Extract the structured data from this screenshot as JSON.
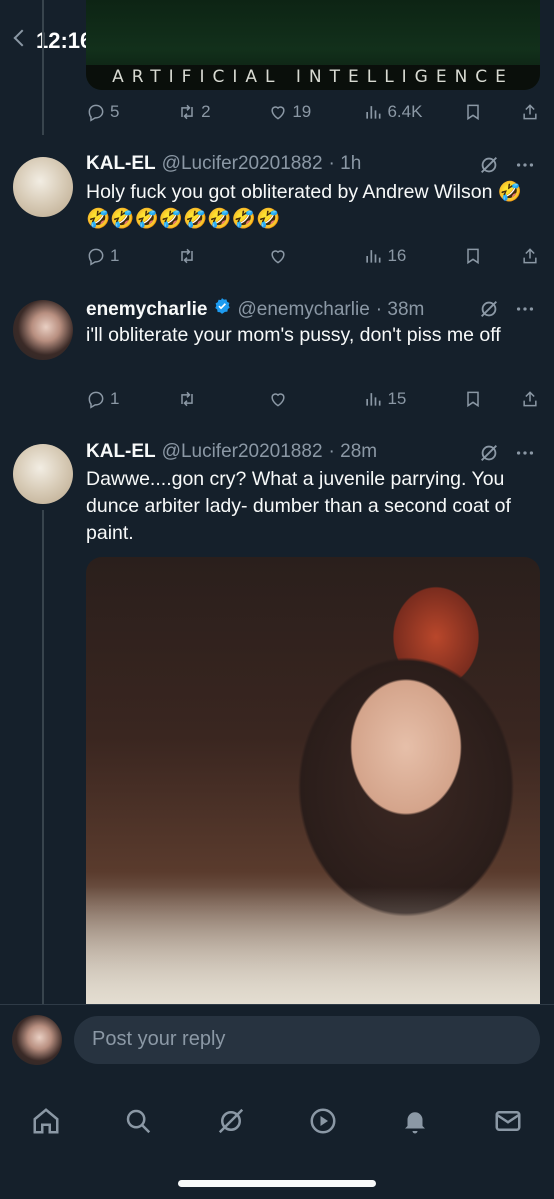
{
  "status_bar": {
    "time": "12:16"
  },
  "banner": {
    "text": "ARTIFICIAL INTELLIGENCE"
  },
  "parent_tweet_actions": {
    "replies": "5",
    "retweets": "2",
    "likes": "19",
    "views": "6.4K"
  },
  "tweets": [
    {
      "name": "KAL-EL",
      "handle": "@Lucifer20201882",
      "time": "· 1h",
      "text": "Holy fuck you got obliterated by Andrew Wilson 🤣🤣🤣🤣🤣🤣🤣🤣🤣",
      "replies": "1",
      "retweets": "",
      "likes": "",
      "views": "16"
    },
    {
      "name": "enemycharlie",
      "handle": "@enemycharlie",
      "time": "· 38m",
      "verified": true,
      "text": "i'll obliterate your mom's pussy, don't piss me off",
      "replies": "1",
      "retweets": "",
      "likes": "",
      "views": "15"
    },
    {
      "name": "KAL-EL",
      "handle": "@Lucifer20201882",
      "time": "· 28m",
      "text": "Dawwe....gon cry? What a juvenile parrying. You dunce arbiter lady- dumber than a second coat of paint."
    }
  ],
  "reply": {
    "placeholder": "Post your reply"
  },
  "colors": {
    "background": "#15202b",
    "accent": "#1d9bf0",
    "muted": "#8b98a5"
  }
}
